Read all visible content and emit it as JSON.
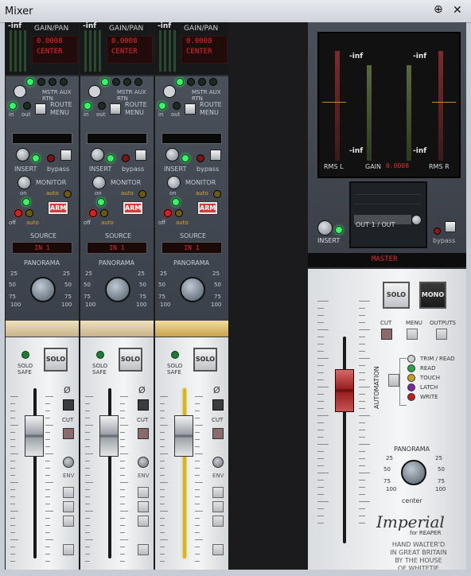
{
  "window": {
    "title": "Mixer",
    "pin_glyph": "⊕",
    "close_glyph": "✕"
  },
  "channels": [
    {
      "inf": "-inf",
      "gain_pan": "GAIN/PAN",
      "gain": "0.0008",
      "pan": "CENTER",
      "mstr_aux_rtn": "MSTR AUX RTN",
      "in": "in",
      "out": "out",
      "route": "ROUTE",
      "menu": "MENU",
      "insert": "INSERT",
      "bypass": "bypass",
      "monitor": "MONITOR",
      "on": "on",
      "auto": "auto",
      "off": "off",
      "auto2": "auto",
      "arm": "ARM",
      "source": "SOURCE",
      "source_value": "IN 1",
      "panorama": "PANORAMA",
      "solo_safe": "SOLO SAFE",
      "solo": "SOLO",
      "cut": "CUT",
      "env": "ENV",
      "phase": "Ø",
      "fader_lit": false
    },
    {
      "inf": "-inf",
      "gain_pan": "GAIN/PAN",
      "gain": "0.0008",
      "pan": "CENTER",
      "mstr_aux_rtn": "MSTR AUX RTN",
      "in": "in",
      "out": "out",
      "route": "ROUTE",
      "menu": "MENU",
      "insert": "INSERT",
      "bypass": "bypass",
      "monitor": "MONITOR",
      "on": "on",
      "auto": "auto",
      "off": "off",
      "auto2": "auto",
      "arm": "ARM",
      "source": "SOURCE",
      "source_value": "IN 1",
      "panorama": "PANORAMA",
      "solo_safe": "SOLO SAFE",
      "solo": "SOLO",
      "cut": "CUT",
      "env": "ENV",
      "phase": "Ø",
      "fader_lit": false
    },
    {
      "inf": "-inf",
      "gain_pan": "GAIN/PAN",
      "gain": "0.0008",
      "pan": "CENTER",
      "mstr_aux_rtn": "MSTR AUX RTN",
      "in": "in",
      "out": "out",
      "route": "ROUTE",
      "menu": "MENU",
      "insert": "INSERT",
      "bypass": "bypass",
      "monitor": "MONITOR",
      "on": "on",
      "auto": "auto",
      "off": "off",
      "auto2": "auto",
      "arm": "ARM",
      "source": "SOURCE",
      "source_value": "IN 1",
      "panorama": "PANORAMA",
      "solo_safe": "SOLO SAFE",
      "solo": "SOLO",
      "cut": "CUT",
      "env": "ENV",
      "phase": "Ø",
      "fader_lit": true
    }
  ],
  "pan_scale": {
    "l25": "25",
    "r25": "25",
    "l50": "50",
    "r50": "50",
    "l75": "75",
    "r75": "75",
    "l100": "100",
    "r100": "100"
  },
  "master": {
    "inf_top_l": "-inf",
    "inf_top_r": "-inf",
    "inf_bot_l": "-inf",
    "inf_bot_r": "-inf",
    "rms_l": "RMS L",
    "gain": "GAIN",
    "gain_value": "0.0008",
    "rms_r": "RMS R",
    "display_text": "OUT 1 / OUT",
    "insert": "INSERT",
    "bypass": "bypass",
    "label": "MASTER",
    "solo": "SOLO",
    "mono": "MONO",
    "cut": "CUT",
    "menu": "MENU",
    "outputs": "OUTPUTS",
    "automation": "AUTOMATION",
    "automation_modes": [
      "TRIM / READ",
      "READ",
      "TOUCH",
      "LATCH",
      "WRITE"
    ],
    "panorama": "PANORAMA",
    "center": "center",
    "brand": "Imperial",
    "brand_sub": "for REAPER",
    "signature": [
      "HAND WALTER'D",
      "IN GREAT BRITAIN",
      "BY THE HOUSE",
      "OF WHITETIE"
    ]
  },
  "colors": {
    "accent_red": "#e03030",
    "led_green": "#3bf26a",
    "bg_dark": "#1b1b1d"
  }
}
